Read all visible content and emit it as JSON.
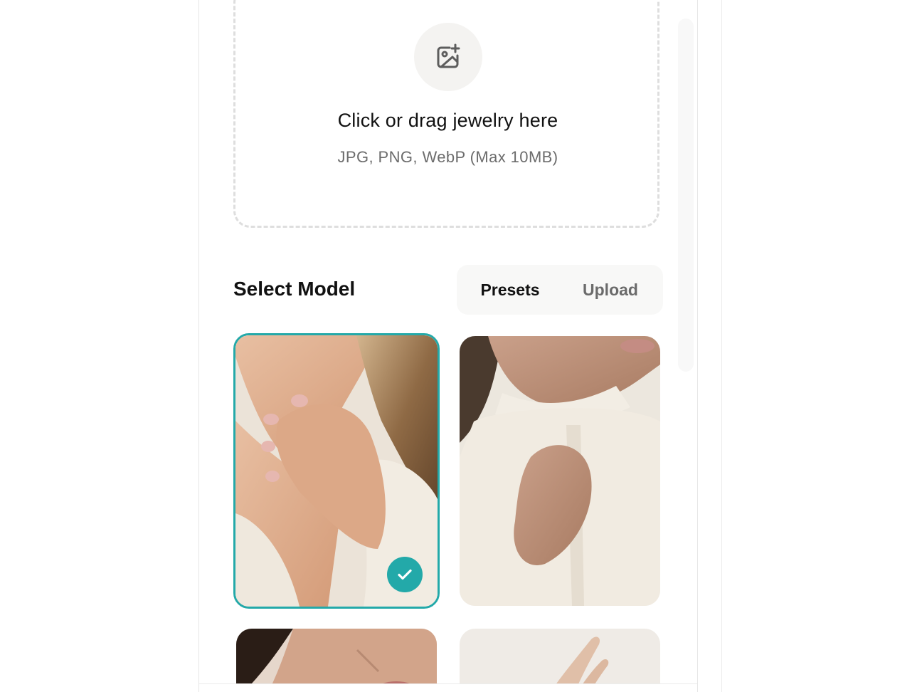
{
  "upload": {
    "title": "Click or drag jewelry here",
    "subtitle": "JPG, PNG, WebP (Max 10MB)",
    "icon": "image-plus-icon"
  },
  "model_section": {
    "title": "Select Model",
    "tabs": [
      {
        "label": "Presets",
        "selected": true
      },
      {
        "label": "Upload",
        "selected": false
      }
    ]
  },
  "models": [
    {
      "selected": true
    },
    {
      "selected": false
    },
    {
      "selected": false
    },
    {
      "selected": false
    }
  ],
  "colors": {
    "accent": "#23a9a9",
    "text_primary": "#111111",
    "text_muted": "#6c6c6c"
  }
}
